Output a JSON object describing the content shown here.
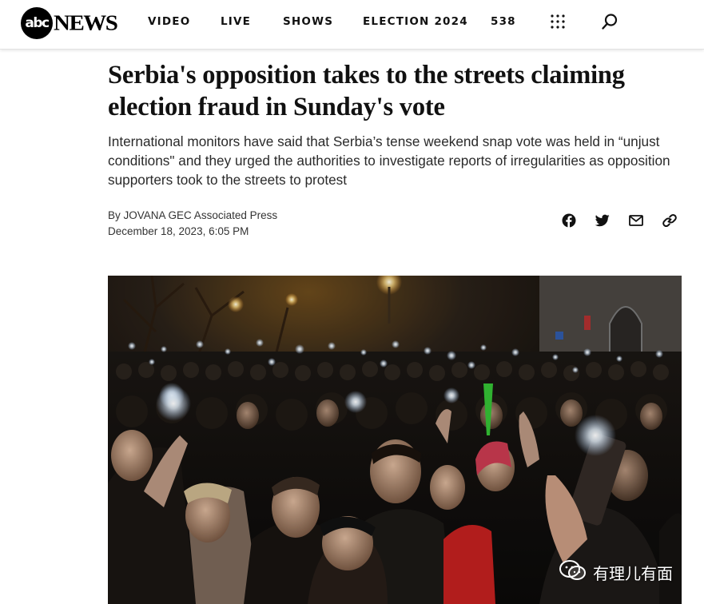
{
  "header": {
    "logo": {
      "abc": "abc",
      "news": "NEWS"
    },
    "nav": [
      {
        "label": "VIDEO"
      },
      {
        "label": "LIVE"
      },
      {
        "label": "SHOWS"
      },
      {
        "label": "ELECTION 2024"
      },
      {
        "label": "538"
      }
    ],
    "icons": {
      "menu": "grid-menu-icon",
      "search": "search-icon"
    }
  },
  "article": {
    "headline": "Serbia's opposition takes to the streets claiming election fraud in Sunday's vote",
    "dek": "International monitors have said that Serbia’s tense weekend snap vote was held in “unjust conditions\" and they urged the authorities to investigate reports of irregularities as opposition supporters took to the streets to protest",
    "byline": {
      "by": "By",
      "author": "JOVANA GEC Associated Press"
    },
    "date": "December 18, 2023, 6:05 PM",
    "share": [
      "facebook-icon",
      "twitter-icon",
      "email-icon",
      "link-icon"
    ]
  },
  "photo": {
    "description_icon": "photo"
  },
  "watermark": {
    "text": "有理儿有面",
    "icon": "wechat-icon"
  },
  "colors": {
    "text": "#111111",
    "dek": "#2a2a2a",
    "header_border": "#e2e2e2"
  }
}
